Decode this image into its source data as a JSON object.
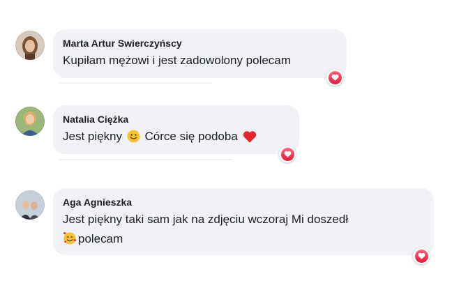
{
  "comments": [
    {
      "author": "Marta Artur Swierczyńscy",
      "text": "Kupiłam mężowi i jest zadowolony polecam",
      "reaction": "heart-reaction-icon"
    },
    {
      "author": "Natalia Ciężka",
      "text_before": "Jest piękny",
      "emoji_1": "smiling-face-emoji",
      "text_middle": "Córce się podoba",
      "emoji_2": "red-heart-emoji",
      "reaction": "heart-reaction-icon"
    },
    {
      "author": "Aga Agnieszka",
      "text_line1": "Jest piękny taki sam jak na zdjęciu wczoraj Mi doszedł",
      "emoji": "smiling-face-with-hearts-emoji",
      "text_line2": "polecam",
      "reaction": "heart-reaction-icon"
    }
  ],
  "colors": {
    "bubble": "#f0f2f5",
    "text": "#1c1e21",
    "reaction_heart": "#f33e58"
  }
}
